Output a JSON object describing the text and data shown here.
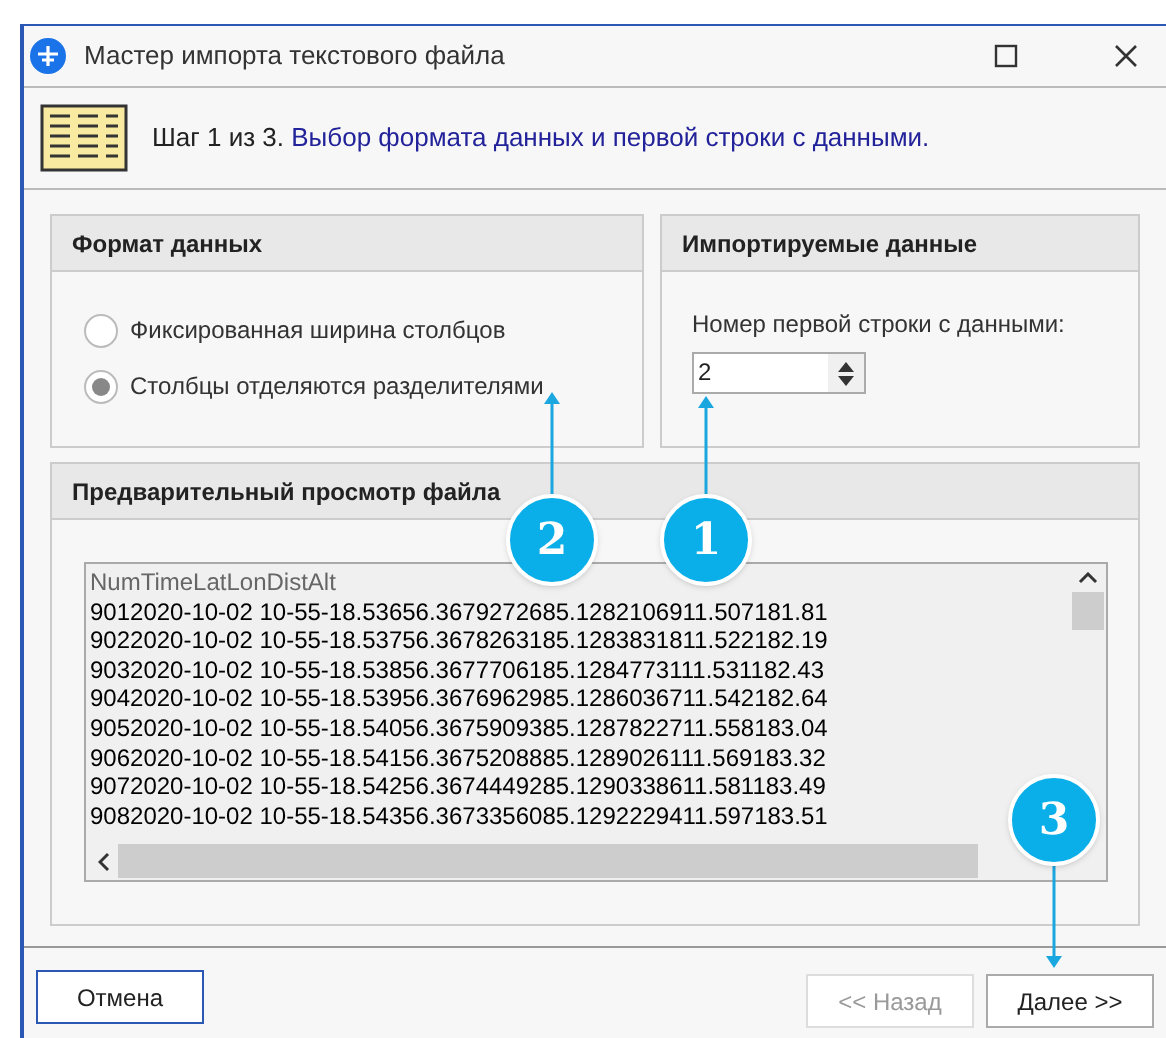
{
  "window": {
    "title": "Мастер импорта текстового файла"
  },
  "step": {
    "label": "Шаг 1 из 3.",
    "description": "Выбор формата данных и первой строки с данными."
  },
  "format_group": {
    "title": "Формат данных",
    "options": [
      {
        "label": "Фиксированная ширина столбцов",
        "selected": false
      },
      {
        "label": "Столбцы отделяются разделителями",
        "selected": true
      }
    ]
  },
  "import_group": {
    "title": "Импортируемые данные",
    "label": "Номер первой строки с данными:",
    "value": "2"
  },
  "preview": {
    "title": "Предварительный просмотр файла",
    "header": "NumTimeLatLonDistAlt",
    "lines": [
      "9012020-10-02 10-55-18.53656.3679272685.1282106911.507181.81",
      "9022020-10-02 10-55-18.53756.3678263185.1283831811.522182.19",
      "9032020-10-02 10-55-18.53856.3677706185.1284773111.531182.43",
      "9042020-10-02 10-55-18.53956.3676962985.1286036711.542182.64",
      "9052020-10-02 10-55-18.54056.3675909385.1287822711.558183.04",
      "9062020-10-02 10-55-18.54156.3675208885.1289026111.569183.32",
      "9072020-10-02 10-55-18.54256.3674449285.1290338611.581183.49",
      "9082020-10-02 10-55-18.54356.3673356085.1292229411.597183.51"
    ]
  },
  "buttons": [
    {
      "label": "Отмена",
      "kind": "cancel",
      "disabled": false
    },
    {
      "label": "<< Назад",
      "kind": "nav",
      "disabled": true
    },
    {
      "label": "Далее >>",
      "kind": "nav",
      "disabled": false
    }
  ],
  "callouts": [
    {
      "number": "2"
    },
    {
      "number": "1"
    },
    {
      "number": "3"
    }
  ]
}
